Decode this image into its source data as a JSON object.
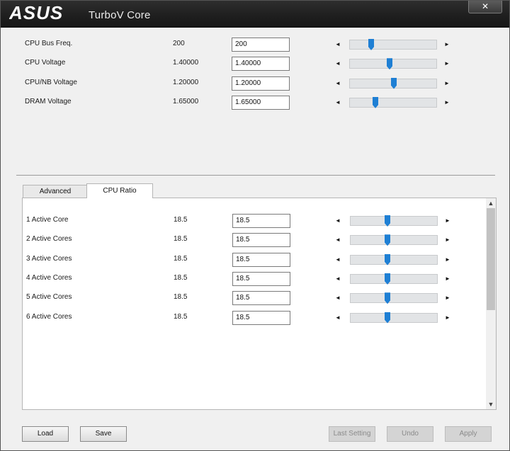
{
  "window": {
    "app_title": "TurboV Core",
    "brand_logo": "ASUS",
    "close_label": "✕"
  },
  "settings": [
    {
      "label": "CPU Bus Freq.",
      "current": "200",
      "input": "200",
      "slider_fraction": 0.22
    },
    {
      "label": "CPU Voltage",
      "current": "1.40000",
      "input": "1.40000",
      "slider_fraction": 0.45
    },
    {
      "label": "CPU/NB Voltage",
      "current": "1.20000",
      "input": "1.20000",
      "slider_fraction": 0.5
    },
    {
      "label": "DRAM Voltage",
      "current": "1.65000",
      "input": "1.65000",
      "slider_fraction": 0.28
    }
  ],
  "tabs": [
    {
      "label": "Advanced",
      "active": false
    },
    {
      "label": "CPU Ratio",
      "active": true
    }
  ],
  "cpu_ratio": [
    {
      "label": "1 Active Core",
      "current": "18.5",
      "input": "18.5",
      "slider_fraction": 0.41
    },
    {
      "label": "2 Active Cores",
      "current": "18.5",
      "input": "18.5",
      "slider_fraction": 0.41
    },
    {
      "label": "3 Active Cores",
      "current": "18.5",
      "input": "18.5",
      "slider_fraction": 0.41
    },
    {
      "label": "4 Active Cores",
      "current": "18.5",
      "input": "18.5",
      "slider_fraction": 0.41
    },
    {
      "label": "5 Active Cores",
      "current": "18.5",
      "input": "18.5",
      "slider_fraction": 0.41
    },
    {
      "label": "6 Active Cores",
      "current": "18.5",
      "input": "18.5",
      "slider_fraction": 0.41
    }
  ],
  "arrows": {
    "left": "◄",
    "right": "►",
    "up": "▲",
    "down": "▼"
  },
  "buttons": {
    "load": "Load",
    "save": "Save",
    "last_setting": "Last Setting",
    "undo": "Undo",
    "apply": "Apply"
  },
  "colors": {
    "titlebar": "#1e1e1e",
    "slider_thumb": "#1e7fd4",
    "panel": "#f0f0f0"
  },
  "icons": {
    "close": "close-icon",
    "logo": "asus-logo",
    "scroll_up": "chevron-up-icon",
    "scroll_down": "chevron-down-icon"
  }
}
